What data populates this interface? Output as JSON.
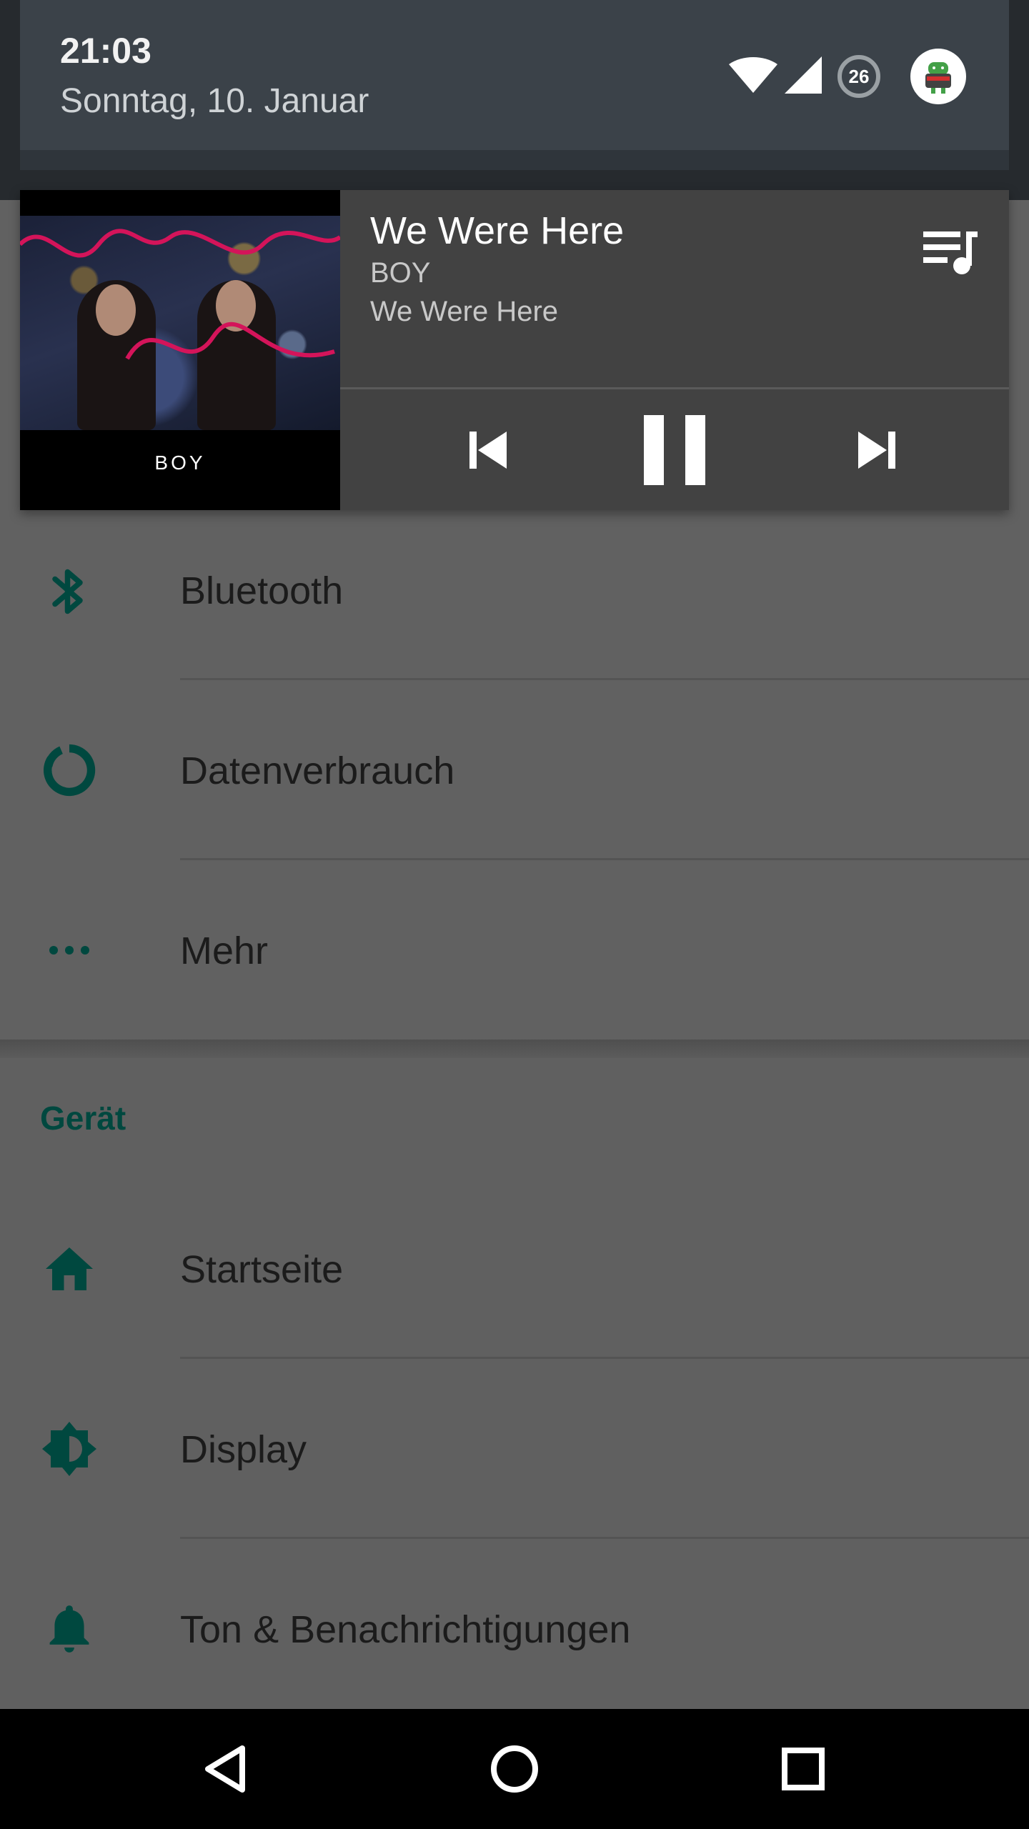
{
  "status_bar": {
    "time": "21:03",
    "date": "Sonntag, 10. Januar",
    "battery_level": "26",
    "icons": [
      "wifi-icon",
      "cell-signal-icon",
      "battery-icon",
      "user-avatar-icon"
    ]
  },
  "media": {
    "title": "We Were Here",
    "artist": "BOY",
    "album": "We Were Here",
    "album_art_text": "BOY",
    "controls": [
      "skip-previous-icon",
      "pause-icon",
      "skip-next-icon"
    ],
    "queue_icon": "queue-music-icon"
  },
  "settings": {
    "wireless_items": [
      {
        "label": "Bluetooth",
        "icon": "bluetooth-icon"
      },
      {
        "label": "Datenverbrauch",
        "icon": "data-usage-icon"
      },
      {
        "label": "Mehr",
        "icon": "more-horiz-icon"
      }
    ],
    "device_header": "Gerät",
    "device_items": [
      {
        "label": "Startseite",
        "icon": "home-icon"
      },
      {
        "label": "Display",
        "icon": "brightness-icon"
      },
      {
        "label": "Ton & Benachrichtigungen",
        "icon": "bell-icon"
      }
    ]
  },
  "navigation": [
    "back-icon",
    "home-circle-icon",
    "recents-icon"
  ],
  "colors": {
    "accent_teal": "#00483f",
    "shade_bg": "#3b4249",
    "media_bg": "#424242",
    "dimmed_list_bg": "#616161"
  }
}
